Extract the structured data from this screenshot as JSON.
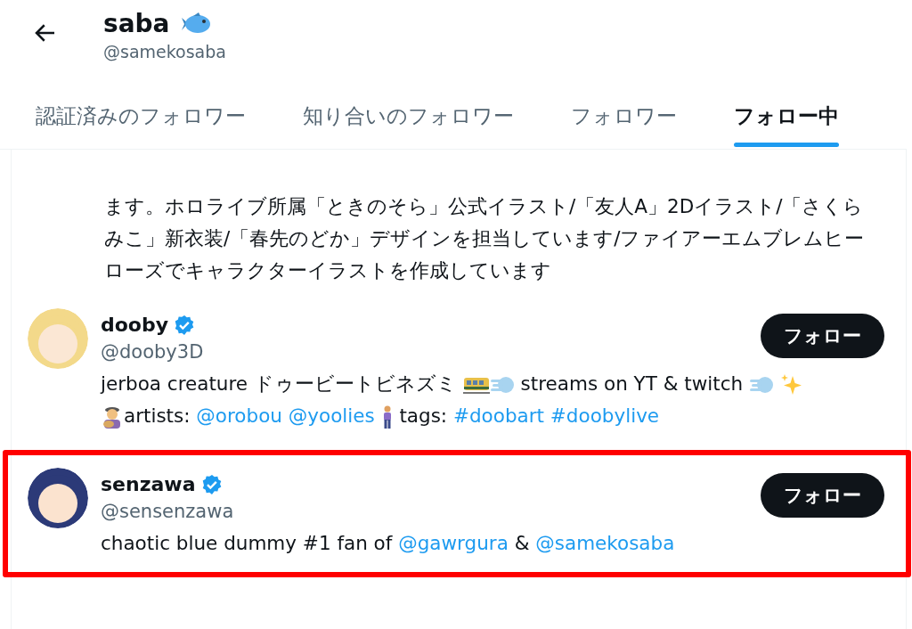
{
  "header": {
    "name": "saba",
    "handle": "@samekosaba"
  },
  "tabs": [
    {
      "label": "認証済みのフォロワー",
      "selected": false
    },
    {
      "label": "知り合いのフォロワー",
      "selected": false
    },
    {
      "label": "フォロワー",
      "selected": false
    },
    {
      "label": "フォロー中",
      "selected": true
    }
  ],
  "bio_above": "ます。ホロライブ所属「ときのそら」公式イラスト/「友人A」2Dイラスト/「さくらみこ」新衣装/「春先のどか」デザインを担当しています/ファイアーエムブレムヒーローズでキャラクターイラストを作成しています",
  "users": [
    {
      "name": "dooby",
      "handle": "@dooby3D",
      "verified": true,
      "highlighted": false,
      "button": "フォロー",
      "bio": [
        {
          "kind": "text",
          "text": "jerboa creature ドゥービートビネズミ "
        },
        {
          "kind": "icon"
        },
        {
          "kind": "icon"
        },
        {
          "kind": "text",
          "text": " streams on YT & twitch "
        },
        {
          "kind": "icon"
        },
        {
          "kind": "space"
        },
        {
          "kind": "icon"
        },
        {
          "kind": "break"
        },
        {
          "kind": "icon"
        },
        {
          "kind": "text",
          "text": "artists: "
        },
        {
          "kind": "link",
          "text": "@orobou"
        },
        {
          "kind": "space"
        },
        {
          "kind": "link",
          "text": "@yoolies"
        },
        {
          "kind": "space"
        },
        {
          "kind": "icon"
        },
        {
          "kind": "text",
          "text": " tags: "
        },
        {
          "kind": "link",
          "text": "#doobart"
        },
        {
          "kind": "space"
        },
        {
          "kind": "link",
          "text": "#doobylive"
        }
      ]
    },
    {
      "name": "senzawa",
      "handle": "@sensenzawa",
      "verified": true,
      "highlighted": true,
      "button": "フォロー",
      "bio": [
        {
          "kind": "text",
          "text": "chaotic blue dummy #1 fan of "
        },
        {
          "kind": "link",
          "text": "@gawrgura"
        },
        {
          "kind": "text",
          "text": " & "
        },
        {
          "kind": "link",
          "text": "@samekosaba"
        }
      ]
    }
  ]
}
